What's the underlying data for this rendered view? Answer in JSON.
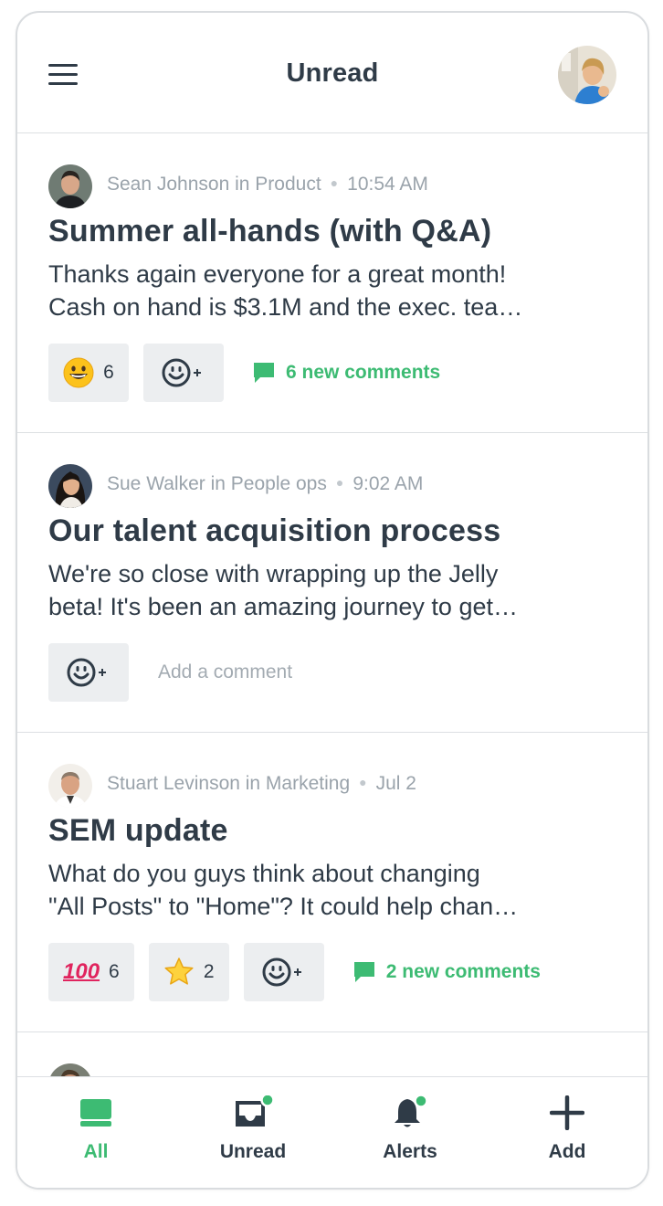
{
  "header": {
    "title": "Unread",
    "menu_icon": "hamburger-menu-icon",
    "avatar": "user-avatar"
  },
  "posts": [
    {
      "author_line": "Sean Johnson in Product",
      "time": "10:54 AM",
      "title": "Summer all-hands (with Q&A)",
      "snippet_line1": "Thanks again everyone for a great month!",
      "snippet_line2": "Cash on hand is $3.1M and the exec. tea…",
      "reactions": [
        {
          "emoji": "grinning-face",
          "count": "6"
        }
      ],
      "comments": "6 new comments"
    },
    {
      "author_line": "Sue Walker in People ops",
      "time": "9:02 AM",
      "title": "Our talent acquisition process",
      "snippet_line1": "We're so close with wrapping up the Jelly",
      "snippet_line2": "beta! It's been an amazing journey to get…",
      "add_comment_placeholder": "Add a comment"
    },
    {
      "author_line": "Stuart Levinson in Marketing",
      "time": "Jul 2",
      "title": "SEM update",
      "snippet_line1": "What do you guys think about changing",
      "snippet_line2": "\"All Posts\" to \"Home\"? It could help chan…",
      "reactions": [
        {
          "emoji": "hundred-points",
          "glyph": "100",
          "count": "6"
        },
        {
          "emoji": "star",
          "count": "2"
        }
      ],
      "comments": "2 new comments"
    }
  ],
  "tabs": [
    {
      "label": "All",
      "icon": "inbox-tray-icon",
      "active": true
    },
    {
      "label": "Unread",
      "icon": "unread-inbox-icon",
      "badge": true
    },
    {
      "label": "Alerts",
      "icon": "bell-icon",
      "badge": true
    },
    {
      "label": "Add",
      "icon": "plus-icon"
    }
  ],
  "colors": {
    "accent_green": "#3dbb73",
    "text_dark": "#2f3b47",
    "text_muted": "#9aa3ab",
    "pill_bg": "#eceef0"
  }
}
